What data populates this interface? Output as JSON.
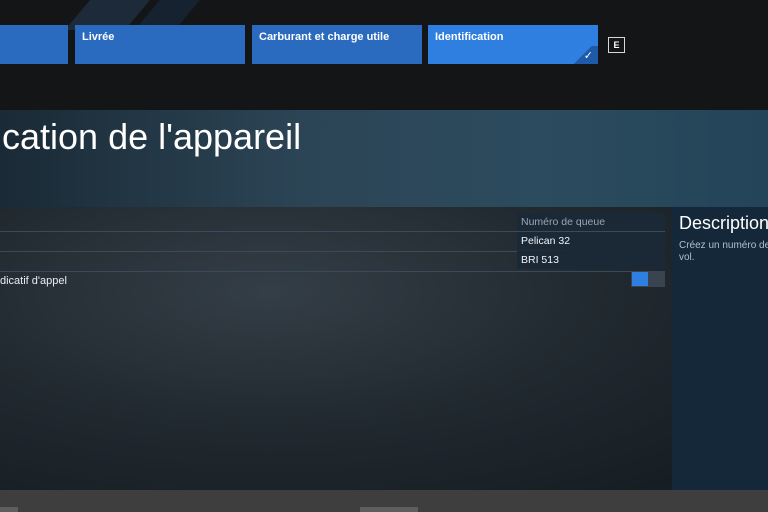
{
  "tabs": [
    {
      "label": ""
    },
    {
      "label": "Livrée"
    },
    {
      "label": "Carburant et charge utile"
    },
    {
      "label": "Identification",
      "active": true
    }
  ],
  "key_hint": "E",
  "page_title": "ication de l'appareil",
  "form": {
    "tail_number_placeholder": "Numéro de queue",
    "row2_value": "Pelican 32",
    "row3_value": "BRI 513",
    "callsign_label": "dicatif d'appel",
    "callsign_toggle_on": true
  },
  "description": {
    "title": "Description",
    "text": "Créez un numéro de vol."
  },
  "colors": {
    "tab": "#2a6bbf",
    "tab_active": "#2f7fe0",
    "accent": "#2f7fe0"
  }
}
